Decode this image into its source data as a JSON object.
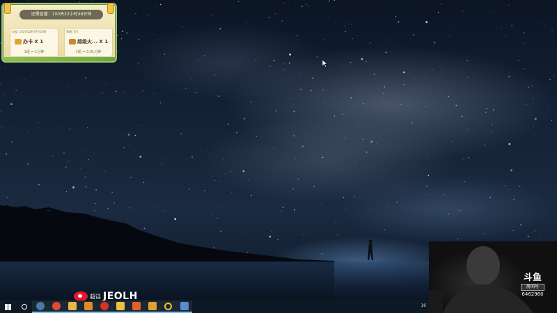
{
  "event_panel": {
    "title": "还需直播：100天22小时48分钟",
    "cards": [
      {
        "tag": "出现: 102天22时47分20秒",
        "item": "办卡 X 1",
        "sub": "1组 = 1分钟"
      },
      {
        "tag": "周期: 6万",
        "item": "超级火... X 1",
        "sub": "1组 = 0.01分钟"
      }
    ]
  },
  "watermark": {
    "prefix": "超话",
    "name": "JEOLH"
  },
  "douyu": {
    "logo": "斗鱼",
    "room_label": "房间号",
    "room_number": "6462960"
  },
  "taskbar": {
    "tray_text": "16",
    "apps": [
      {
        "name": "start-button",
        "color": "#ffffff"
      },
      {
        "name": "search-icon",
        "color": "#ffffff"
      },
      {
        "name": "steam-icon",
        "color": "#4a78a8"
      },
      {
        "name": "chrome-icon",
        "color": "#e04a3a"
      },
      {
        "name": "folder-icon",
        "color": "#e8b54a"
      },
      {
        "name": "app-icon",
        "color": "#e08a2a"
      },
      {
        "name": "netease-music-icon",
        "color": "#d6322a"
      },
      {
        "name": "app-icon",
        "color": "#f0c040"
      },
      {
        "name": "app-icon",
        "color": "#e0602a"
      },
      {
        "name": "app-icon",
        "color": "#e0a030"
      },
      {
        "name": "ring-icon",
        "color": "#f0c030"
      },
      {
        "name": "app-icon",
        "color": "#5a8ad0"
      }
    ]
  }
}
